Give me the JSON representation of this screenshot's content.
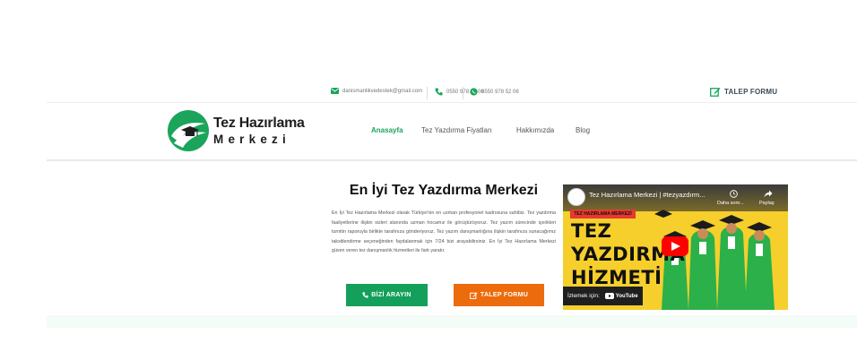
{
  "topbar": {
    "email": "danismanlikvedestek@gmail.com",
    "phone": "0550 978 52 06",
    "whatsapp": "0550 978 52 06",
    "request_form": "TALEP FORMU"
  },
  "brand": {
    "line1": "Tez Hazırlama",
    "line2": "Merkezi"
  },
  "nav": [
    {
      "label": "Anasayfa",
      "active": true
    },
    {
      "label": "Tez Yazdırma Fiyatları",
      "active": false
    },
    {
      "label": "Hakkımızda",
      "active": false
    },
    {
      "label": "Blog",
      "active": false
    }
  ],
  "hero": {
    "title": "En İyi Tez Yazdırma Merkezi",
    "body": "En İyi Tez Hazırlama Merkezi olarak Türkiye'nin en uzman profesyonel kadrosuna sahibiz. Tez yazdırma faaliyetlerine ilişkin sizleri alanında uzman hocamız ile görüştürüyoruz. Tez yazım sürecinde içerikleri turnitin raporuyla birlikte tarafınıza gönderiyoruz. Tez yazım danışmanlığına ilişkin tarafınıza sunacağımız taksitlendirme seçeneğinden faydalanmak için 7/24 bizi arayabilirsiniz. En İyi Tez Hazırlama Merkezi güven veren tez danışmanlık hizmetleri ile fark yaratır.",
    "call_button": "BİZİ ARAYIN",
    "form_button": "TALEP FORMU"
  },
  "video": {
    "title": "Tez Hazırlama Merkezi | #tezyazdırm...",
    "watch_later": "Daha sonr...",
    "share": "Paylaş",
    "band": "TEZ HAZIRLAMA MERKEZİ",
    "big_line1": "TEZ",
    "big_line2": "YAZDIRMA",
    "big_line3": "HİZMETİ",
    "watch_on": "İzlemek için:",
    "platform": "YouTube"
  },
  "colors": {
    "accent_green": "#14a05a",
    "accent_orange": "#ec6b0c",
    "video_bg": "#f6cf2c"
  }
}
